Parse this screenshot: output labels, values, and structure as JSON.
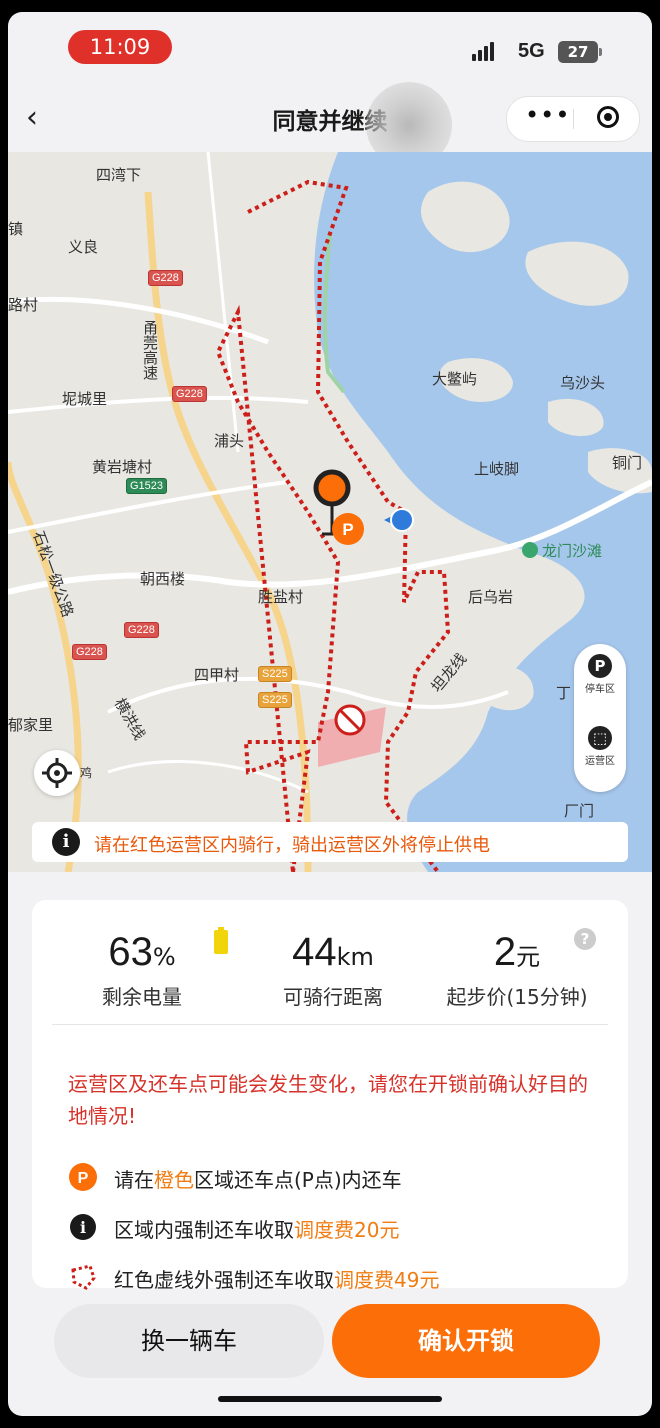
{
  "status_bar": {
    "time": "11:09",
    "network": "5G",
    "battery": "27"
  },
  "header": {
    "title": "同意并继续"
  },
  "map": {
    "places": [
      "四湾下",
      "镇",
      "义良",
      "路村",
      "甬莞高速",
      "坭城里",
      "浦头",
      "黄岩塘村",
      "大鳖屿",
      "乌沙头",
      "上岐脚",
      "铜门",
      "龙门沙滩",
      "石松一级公路",
      "朝西楼",
      "胜盐村",
      "后乌岩",
      "四甲村",
      "坦龙线",
      "丁",
      "郁家里",
      "横洪线",
      "厂门",
      "鸡"
    ],
    "road_shields": [
      "G228",
      "G228",
      "G1523",
      "G228",
      "G228",
      "S225",
      "S225"
    ],
    "side_buttons": [
      {
        "icon": "P",
        "label": "停车区"
      },
      {
        "label": "运营区"
      }
    ],
    "notice": "请在红色运营区内骑行，骑出运营区外将停止供电",
    "zone_color": "#cc1f1a",
    "water_color": "#a6c7ec"
  },
  "stats": [
    {
      "value": "63",
      "unit": "%",
      "label": "剩余电量"
    },
    {
      "value": "44",
      "unit": "km",
      "label": "可骑行距离"
    },
    {
      "value": "2",
      "unit": "元",
      "label": "起步价(15分钟)"
    }
  ],
  "help_icon": "?",
  "warning": "运营区及还车点可能会发生变化，请您在开锁前确认好目的地情况!",
  "rules": [
    {
      "icon": "parking-icon",
      "pre": "请在",
      "hl": "橙色",
      "post": "区域还车点(P点)内还车"
    },
    {
      "icon": "info-icon",
      "pre": "区域内强制还车收取",
      "hl": "调度费20元",
      "post": ""
    },
    {
      "icon": "zone-boundary-icon",
      "pre": "红色虚线外强制还车收取",
      "hl": "调度费49元",
      "post": ""
    }
  ],
  "buttons": {
    "change": "换一辆车",
    "confirm": "确认开锁"
  },
  "colors": {
    "accent": "#fb6e08",
    "warning": "#d6322a",
    "highlight": "#f07c12"
  }
}
